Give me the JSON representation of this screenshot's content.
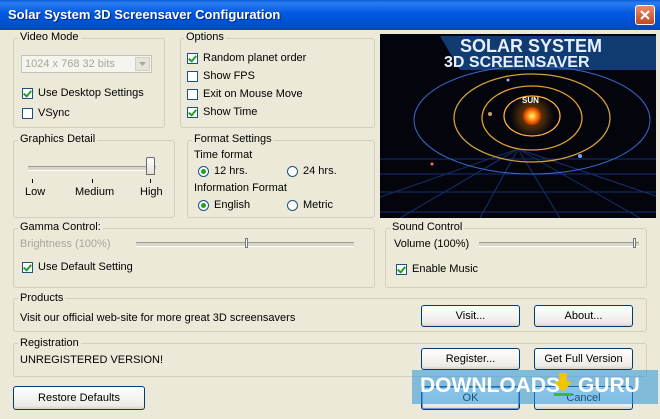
{
  "window": {
    "title": "Solar System 3D Screensaver Configuration"
  },
  "video_mode": {
    "legend": "Video Mode",
    "resolution": "1024 x 768 32 bits",
    "use_desktop_settings": {
      "label": "Use Desktop Settings",
      "checked": true
    },
    "vsync": {
      "label": "VSync",
      "checked": false
    }
  },
  "options": {
    "legend": "Options",
    "items": [
      {
        "label": "Random planet order",
        "checked": true
      },
      {
        "label": "Show FPS",
        "checked": false
      },
      {
        "label": "Exit on Mouse Move",
        "checked": false
      },
      {
        "label": "Show Time",
        "checked": true
      }
    ]
  },
  "preview": {
    "line1": "SOLAR SYSTEM",
    "line2": "3D SCREENSAVER",
    "sun_label": "SUN"
  },
  "graphics": {
    "legend": "Graphics Detail",
    "low": "Low",
    "medium": "Medium",
    "high": "High",
    "level": "High"
  },
  "format": {
    "legend": "Format Settings",
    "time_format_label": "Time format",
    "h12": "12 hrs.",
    "h24": "24 hrs.",
    "time_selected": "12 hrs.",
    "info_format_label": "Information Format",
    "english": "English",
    "metric": "Metric",
    "info_selected": "English"
  },
  "gamma": {
    "legend": "Gamma Control:",
    "brightness_label": "Brightness (100%)",
    "brightness_percent": 100,
    "use_default": {
      "label": "Use Default Setting",
      "checked": true
    }
  },
  "sound": {
    "legend": "Sound Control",
    "volume_label": "Volume (100%)",
    "volume_percent": 100,
    "enable_music": {
      "label": "Enable Music",
      "checked": true
    }
  },
  "products": {
    "legend": "Products",
    "text": "Visit our official web-site for more great 3D screensavers",
    "visit_button": "Visit...",
    "about_button": "About..."
  },
  "registration": {
    "legend": "Registration",
    "status": "UNREGISTERED VERSION!",
    "register_button": "Register...",
    "full_version_button": "Get Full Version"
  },
  "footer": {
    "restore_button": "Restore Defaults",
    "ok_button": "OK",
    "cancel_button": "Cancel"
  },
  "watermark": {
    "text_left": "DOWNLOADS",
    "text_right": "GURU"
  }
}
